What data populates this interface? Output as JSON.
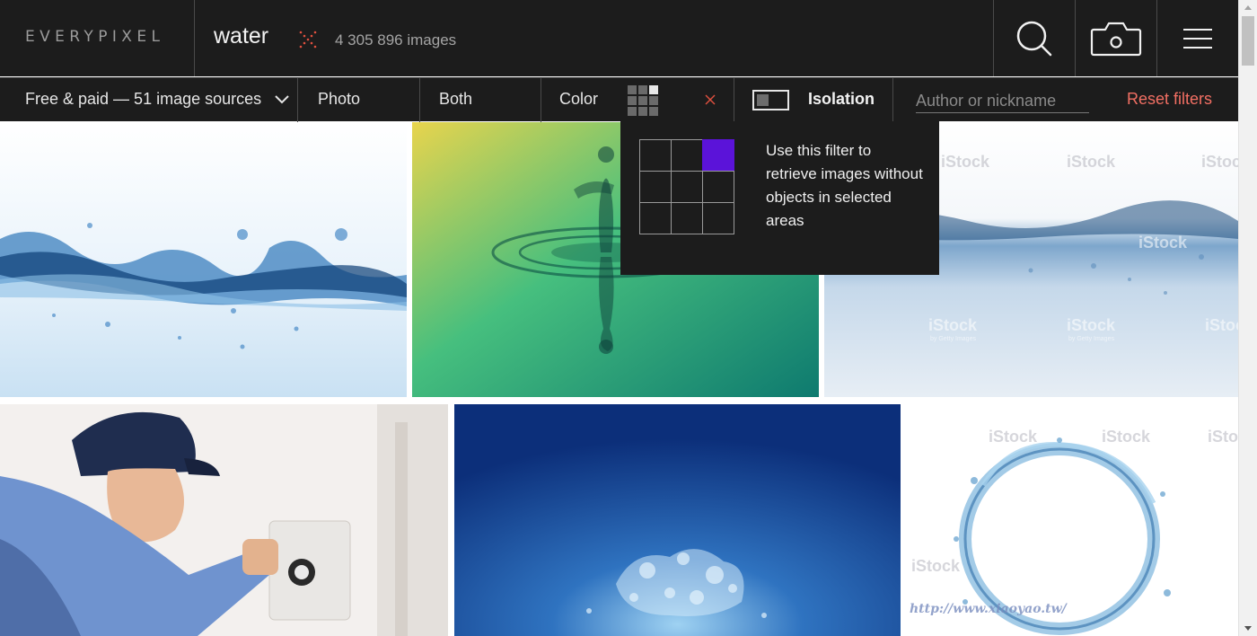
{
  "header": {
    "logo_text": "EVERYPIXEL",
    "query": "water",
    "result_count": "4 305 896 images",
    "icons": [
      "search-icon",
      "camera-icon",
      "menu-icon"
    ]
  },
  "filters": {
    "source_label": "Free & paid — 51 image sources",
    "type_label": "Photo",
    "orientation_label": "Both",
    "color_label": "Color",
    "isolation_label": "Isolation",
    "author_placeholder": "Author or nickname",
    "reset_label": "Reset filters"
  },
  "popup": {
    "description": "Use this filter to retrieve images without objects in selected areas",
    "selected_area": [
      0,
      2
    ],
    "selected_color": "#5b13d9"
  },
  "watermarks": {
    "istock": "iStock",
    "istock_sub": "by Getty Images",
    "site": "http://www.xiaoyao.tw/"
  },
  "colors": {
    "header_bg": "#1c1c1c",
    "reset_accent": "#f26f63",
    "selection_accent": "#5b13d9"
  }
}
